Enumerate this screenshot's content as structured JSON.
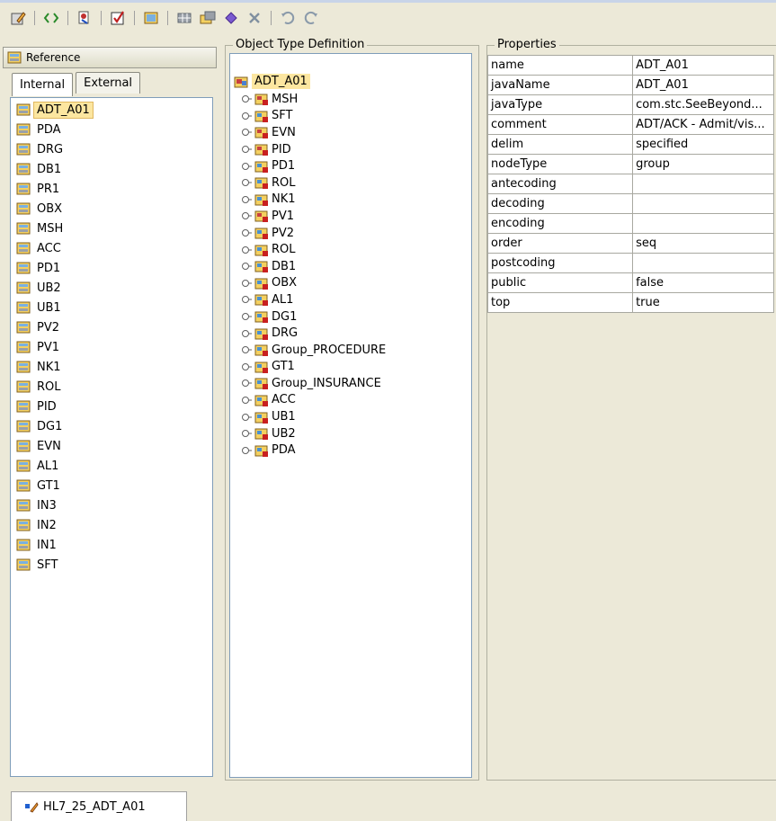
{
  "toolbar": {
    "buttons": [
      "edit-icon",
      "code-icon",
      "link-icon",
      "validate-icon",
      "segment-icon",
      "grid-icon",
      "add-segment-icon",
      "diamond-icon",
      "delete-icon",
      "undo-icon",
      "redo-icon"
    ]
  },
  "reference": {
    "title": "Reference",
    "tabs": [
      "Internal",
      "External"
    ],
    "items": [
      "ADT_A01",
      "PDA",
      "DRG",
      "DB1",
      "PR1",
      "OBX",
      "MSH",
      "ACC",
      "PD1",
      "UB2",
      "UB1",
      "PV2",
      "PV1",
      "NK1",
      "ROL",
      "PID",
      "DG1",
      "EVN",
      "AL1",
      "GT1",
      "IN3",
      "IN2",
      "IN1",
      "SFT"
    ]
  },
  "otd": {
    "title": "Object Type Definition",
    "root": "ADT_A01",
    "nodes": [
      "MSH",
      "SFT",
      "EVN",
      "PID",
      "PD1",
      "ROL",
      "NK1",
      "PV1",
      "PV2",
      "ROL",
      "DB1",
      "OBX",
      "AL1",
      "DG1",
      "DRG",
      "Group_PROCEDURE",
      "GT1",
      "Group_INSURANCE",
      "ACC",
      "UB1",
      "UB2",
      "PDA"
    ]
  },
  "properties": {
    "title": "Properties",
    "rows": [
      {
        "key": "name",
        "value": "ADT_A01"
      },
      {
        "key": "javaName",
        "value": "ADT_A01"
      },
      {
        "key": "javaType",
        "value": "com.stc.SeeBeyond..."
      },
      {
        "key": "comment",
        "value": "ADT/ACK - Admit/vis..."
      },
      {
        "key": "delim",
        "value": "specified"
      },
      {
        "key": "nodeType",
        "value": "group"
      },
      {
        "key": "antecoding",
        "value": ""
      },
      {
        "key": "decoding",
        "value": ""
      },
      {
        "key": "encoding",
        "value": ""
      },
      {
        "key": "order",
        "value": "seq"
      },
      {
        "key": "postcoding",
        "value": ""
      },
      {
        "key": "public",
        "value": "false"
      },
      {
        "key": "top",
        "value": "true"
      }
    ]
  },
  "status": {
    "document_tab": "HL7_25_ADT_A01"
  },
  "colors": {
    "background": "#ece9d8",
    "selection": "#fce6a0",
    "border": "#7f9db9"
  }
}
